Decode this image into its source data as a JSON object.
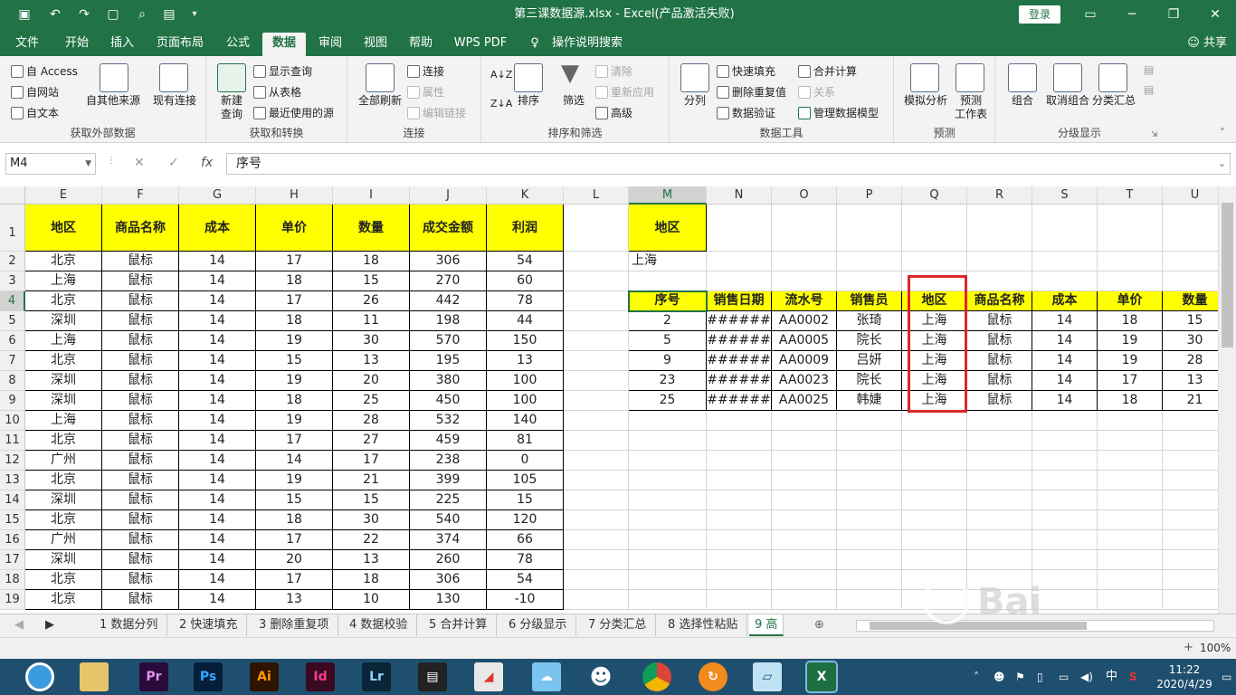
{
  "window": {
    "title": "第三课数据源.xlsx  -  Excel(产品激活失败)",
    "login_label": "登录"
  },
  "menu": {
    "tabs": [
      "文件",
      "开始",
      "插入",
      "页面布局",
      "公式",
      "数据",
      "审阅",
      "视图",
      "帮助",
      "WPS PDF",
      "操作说明搜索"
    ],
    "active_tab": "数据",
    "share_label": "共享"
  },
  "ribbon": {
    "get_external": {
      "label": "获取外部数据",
      "from_access": "自 Access",
      "from_web": "自网站",
      "from_text": "自文本",
      "from_other": "自其他来源",
      "existing": "现有连接"
    },
    "get_transform": {
      "label": "获取和转换",
      "new_query": "新建\n查询",
      "show_query": "显示查询",
      "from_table": "从表格",
      "recent_sources": "最近使用的源"
    },
    "connections": {
      "label": "连接",
      "refresh_all": "全部刷新",
      "connections": "连接",
      "properties": "属性",
      "edit_links": "编辑链接"
    },
    "sort_filter": {
      "label": "排序和筛选",
      "sort": "排序",
      "filter": "筛选",
      "clear": "清除",
      "reapply": "重新应用",
      "advanced": "高级"
    },
    "data_tools": {
      "label": "数据工具",
      "text_to_columns": "分列",
      "flash_fill": "快速填充",
      "remove_duplicates": "删除重复值",
      "data_validation": "数据验证",
      "consolidate": "合并计算",
      "relationships": "关系",
      "manage_model": "管理数据模型"
    },
    "forecast": {
      "label": "预测",
      "what_if": "模拟分析",
      "forecast_sheet": "预测\n工作表"
    },
    "outline": {
      "label": "分级显示",
      "group": "组合",
      "ungroup": "取消组合",
      "subtotal": "分类汇总"
    }
  },
  "formula_bar": {
    "name_box": "M4",
    "cancel": "✕",
    "enter": "✓",
    "fx": "fx",
    "content": "序号"
  },
  "sheet": {
    "columns": [
      "E",
      "F",
      "G",
      "H",
      "I",
      "J",
      "K",
      "L",
      "M",
      "N",
      "O",
      "P",
      "Q",
      "R",
      "S",
      "T",
      "U"
    ],
    "selected_column": "M",
    "rows": [
      "1",
      "2",
      "3",
      "4",
      "5",
      "6",
      "7",
      "8",
      "9",
      "10",
      "11",
      "12",
      "13",
      "14",
      "15",
      "16",
      "17",
      "18",
      "19"
    ],
    "selected_row": "4",
    "left_table": {
      "headers": [
        "地区",
        "商品名称",
        "成本",
        "单价",
        "数量",
        "成交金额",
        "利润"
      ],
      "rows": [
        [
          "北京",
          "鼠标",
          "14",
          "17",
          "18",
          "306",
          "54"
        ],
        [
          "上海",
          "鼠标",
          "14",
          "18",
          "15",
          "270",
          "60"
        ],
        [
          "北京",
          "鼠标",
          "14",
          "17",
          "26",
          "442",
          "78"
        ],
        [
          "深圳",
          "鼠标",
          "14",
          "18",
          "11",
          "198",
          "44"
        ],
        [
          "上海",
          "鼠标",
          "14",
          "19",
          "30",
          "570",
          "150"
        ],
        [
          "北京",
          "鼠标",
          "14",
          "15",
          "13",
          "195",
          "13"
        ],
        [
          "深圳",
          "鼠标",
          "14",
          "19",
          "20",
          "380",
          "100"
        ],
        [
          "深圳",
          "鼠标",
          "14",
          "18",
          "25",
          "450",
          "100"
        ],
        [
          "上海",
          "鼠标",
          "14",
          "19",
          "28",
          "532",
          "140"
        ],
        [
          "北京",
          "鼠标",
          "14",
          "17",
          "27",
          "459",
          "81"
        ],
        [
          "广州",
          "鼠标",
          "14",
          "14",
          "17",
          "238",
          "0"
        ],
        [
          "北京",
          "鼠标",
          "14",
          "19",
          "21",
          "399",
          "105"
        ],
        [
          "深圳",
          "鼠标",
          "14",
          "15",
          "15",
          "225",
          "15"
        ],
        [
          "北京",
          "鼠标",
          "14",
          "18",
          "30",
          "540",
          "120"
        ],
        [
          "广州",
          "鼠标",
          "14",
          "17",
          "22",
          "374",
          "66"
        ],
        [
          "深圳",
          "鼠标",
          "14",
          "20",
          "13",
          "260",
          "78"
        ],
        [
          "北京",
          "鼠标",
          "14",
          "17",
          "18",
          "306",
          "54"
        ],
        [
          "北京",
          "鼠标",
          "14",
          "13",
          "10",
          "130",
          "-10"
        ]
      ]
    },
    "criteria": {
      "header": "地区",
      "value": "上海"
    },
    "result_table": {
      "headers": [
        "序号",
        "销售日期",
        "流水号",
        "销售员",
        "地区",
        "商品名称",
        "成本",
        "单价",
        "数量"
      ],
      "rows": [
        [
          "2",
          "######",
          "AA0002",
          "张琦",
          "上海",
          "鼠标",
          "14",
          "18",
          "15"
        ],
        [
          "5",
          "######",
          "AA0005",
          "院长",
          "上海",
          "鼠标",
          "14",
          "19",
          "30"
        ],
        [
          "9",
          "######",
          "AA0009",
          "吕妍",
          "上海",
          "鼠标",
          "14",
          "19",
          "28"
        ],
        [
          "23",
          "######",
          "AA0023",
          "院长",
          "上海",
          "鼠标",
          "14",
          "17",
          "13"
        ],
        [
          "25",
          "######",
          "AA0025",
          "韩婕",
          "上海",
          "鼠标",
          "14",
          "18",
          "21"
        ]
      ]
    }
  },
  "sheet_tabs": [
    "1 数据分列",
    "2 快速填充",
    "3 删除重复项",
    "4 数据校验",
    "5 合并计算",
    "6 分级显示",
    "7 分类汇总",
    "8 选择性粘贴",
    "9 高"
  ],
  "active_sheet": "9 高",
  "status": {
    "zoom": "100%"
  },
  "taskbar": {
    "apps": [
      "Pr",
      "Ps",
      "Ai",
      "Id",
      "Lr"
    ],
    "time": "11:22",
    "date": "2020/4/29",
    "ime": "中"
  },
  "colors": {
    "excel_green": "#217346",
    "header_yellow": "#ffff00",
    "highlight_red": "#d9272e"
  }
}
